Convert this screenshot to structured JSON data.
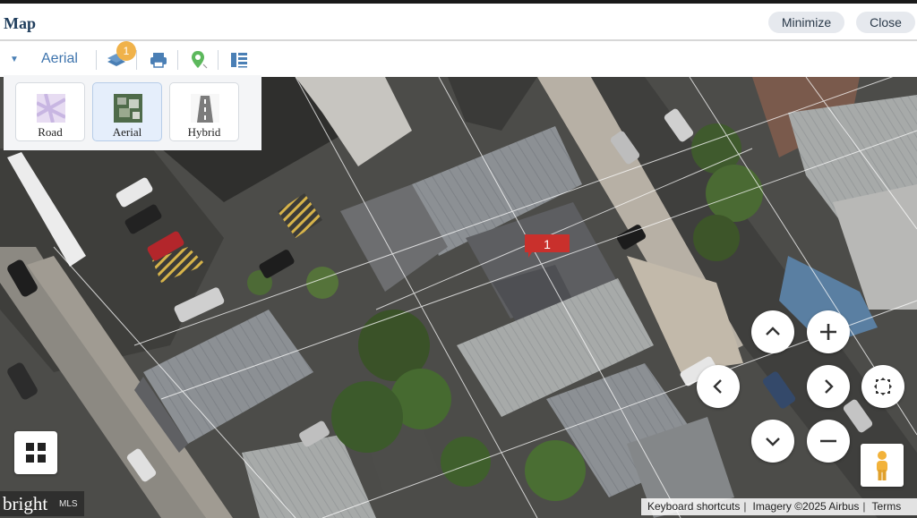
{
  "header": {
    "title": "Map",
    "minimize_label": "Minimize",
    "close_label": "Close"
  },
  "toolbar": {
    "map_type_label": "Aerial",
    "layers_badge_count": "1",
    "icons": [
      "caret-down-icon",
      "layers-icon",
      "print-icon",
      "location-pin-icon",
      "list-panel-icon"
    ]
  },
  "map_types": [
    {
      "label": "Road",
      "icon": "road-thumb-icon",
      "selected": false
    },
    {
      "label": "Aerial",
      "icon": "aerial-thumb-icon",
      "selected": true
    },
    {
      "label": "Hybrid",
      "icon": "hybrid-thumb-icon",
      "selected": false
    }
  ],
  "map": {
    "marker_label": "1",
    "controls": [
      "pan-up-icon",
      "zoom-in-icon",
      "pan-left-icon",
      "pan-right-icon",
      "fullscreen-icon",
      "pan-down-icon",
      "zoom-out-icon"
    ]
  },
  "footer": {
    "keyboard_shortcuts": "Keyboard shortcuts",
    "imagery": "Imagery ©2025 Airbus",
    "terms": "Terms",
    "logo_text": "bright",
    "logo_suffix": "MLS"
  },
  "colors": {
    "accent": "#3e74ad",
    "marker": "#c9302c",
    "badge": "#f0b24a",
    "title": "#1f3d5c"
  }
}
